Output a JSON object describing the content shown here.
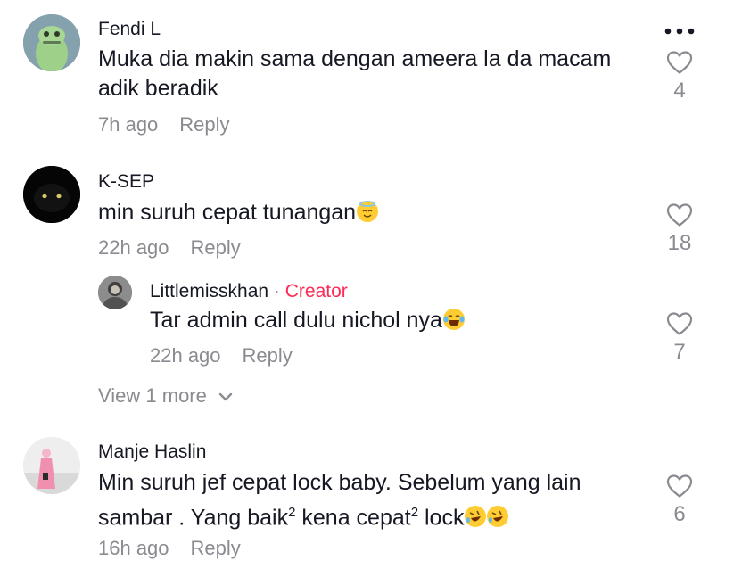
{
  "menu": {
    "icon": "more-dots-icon"
  },
  "comments": [
    {
      "username": "Fendi L",
      "text_line1": "Muka dia makin sama dengan ameera la da macam",
      "text_line2": "adik beradik",
      "time": "7h ago",
      "reply_label": "Reply",
      "likes": "4"
    },
    {
      "username": "K-SEP",
      "text": "min suruh cepat tunangan",
      "emoji": "innocent-face-emoji",
      "time": "22h ago",
      "reply_label": "Reply",
      "likes": "18"
    },
    {
      "username": "Manje Haslin",
      "text_line1": "Min suruh jef cepat lock baby. Sebelum yang lain",
      "text_line2_a": "sambar . Yang baik",
      "sup1": "2",
      "text_line2_b": " kena cepat",
      "sup2": "2",
      "text_line2_c": " lock",
      "emoji": "rolling-laughing-emoji",
      "time": "16h ago",
      "reply_label": "Reply",
      "likes": "6"
    }
  ],
  "reply": {
    "username": "Littlemisskhan",
    "separator": " · ",
    "badge": "Creator",
    "text": "Tar admin call dulu nichol nya",
    "emoji": "tears-of-joy-emoji",
    "time": "22h ago",
    "reply_label": "Reply",
    "likes": "7"
  },
  "view_more": {
    "label": "View 1 more",
    "icon": "chevron-down-icon"
  }
}
